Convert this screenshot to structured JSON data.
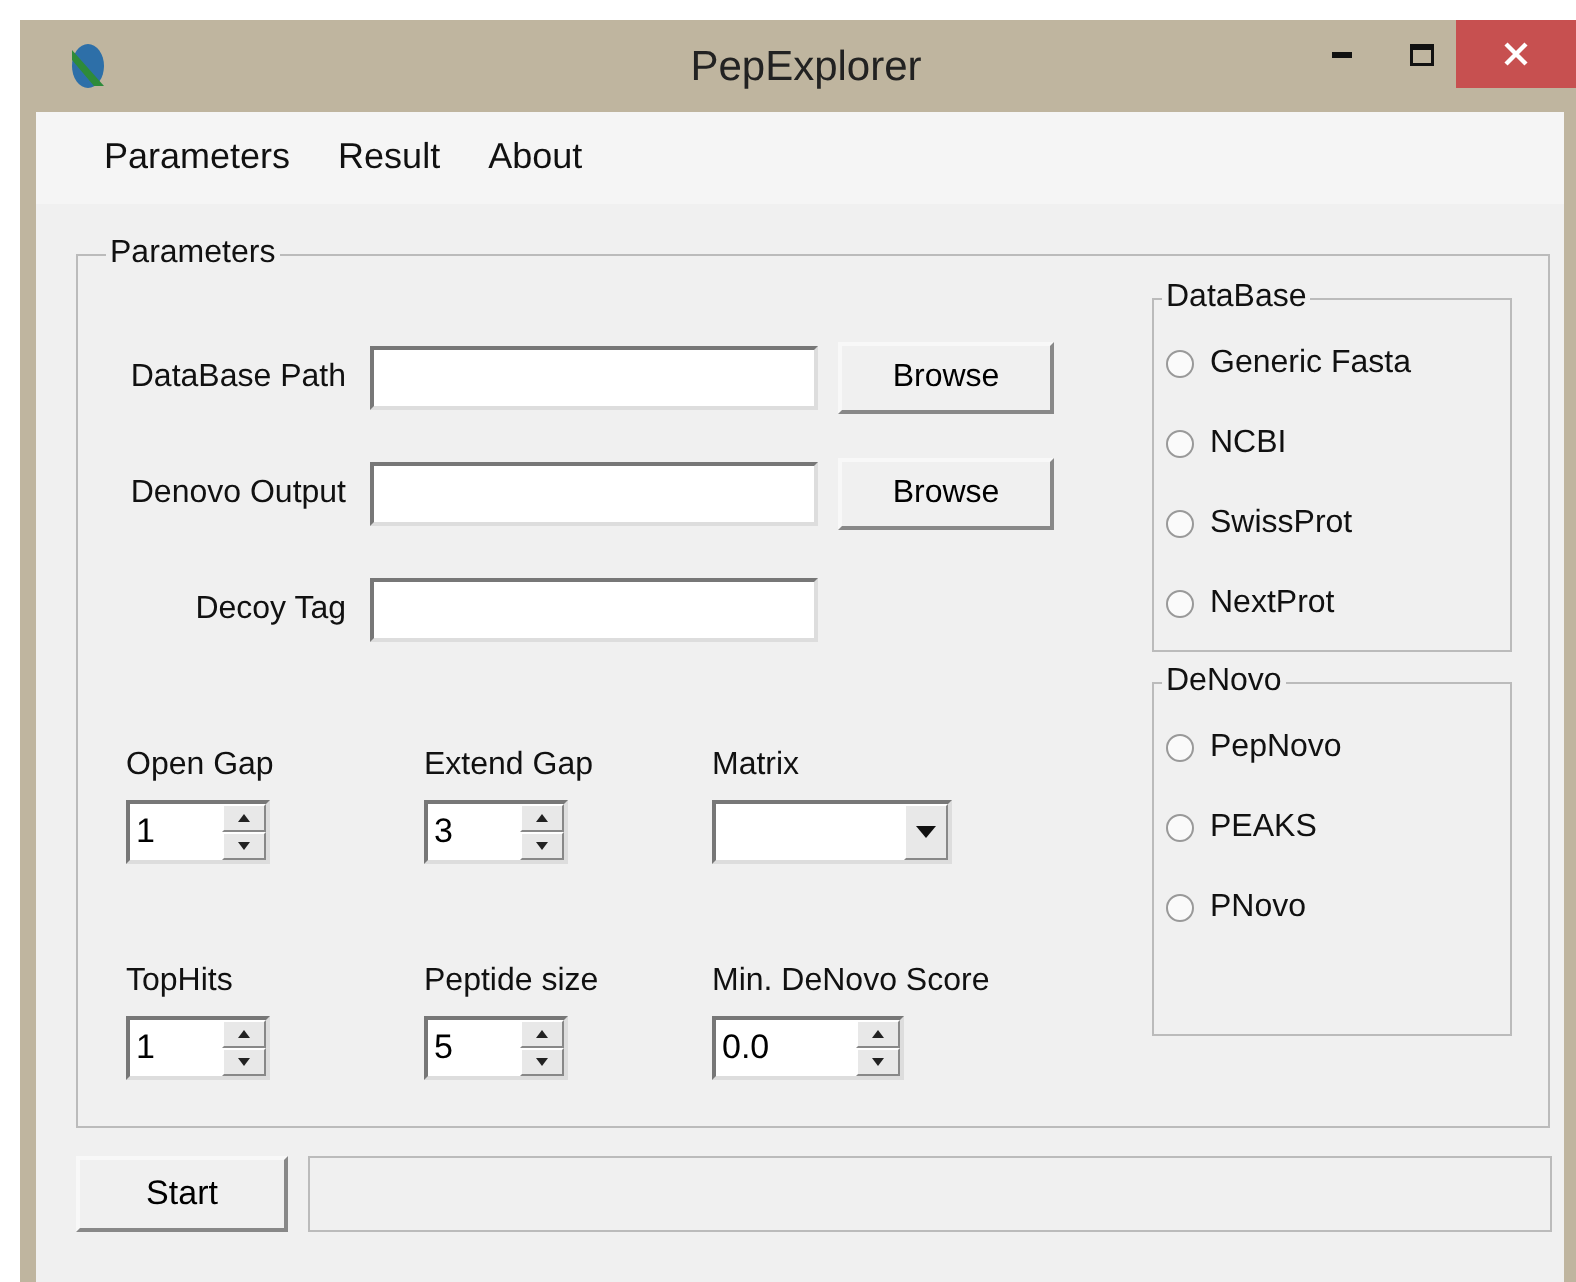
{
  "window": {
    "title": "PepExplorer"
  },
  "menu": [
    "Parameters",
    "Result",
    "About"
  ],
  "parameters": {
    "title": "Parameters",
    "paths": [
      {
        "label": "DataBase Path",
        "button": "Browse"
      },
      {
        "label": "Denovo Output",
        "button": "Browse"
      },
      {
        "label": "Decoy Tag"
      }
    ],
    "settings": [
      {
        "label": "Open Gap",
        "kind": "spinner",
        "value": "1"
      },
      {
        "label": "Extend Gap",
        "kind": "spinner",
        "value": "3"
      },
      {
        "label": "Matrix",
        "kind": "dropdown"
      },
      {
        "label": "TopHits",
        "kind": "spinner",
        "value": "1"
      },
      {
        "label": "Peptide size",
        "kind": "spinner",
        "value": "5"
      },
      {
        "label": "Min. DeNovo Score",
        "kind": "spinner",
        "value": "0.0"
      }
    ],
    "groups": [
      {
        "title": "DataBase",
        "options": [
          {
            "label": "Generic Fasta",
            "selected": false
          },
          {
            "label": "NCBI",
            "selected": false
          },
          {
            "label": "SwissProt",
            "selected": false
          },
          {
            "label": "NextProt",
            "selected": false
          }
        ]
      },
      {
        "title": "DeNovo",
        "options": [
          {
            "label": "PepNovo",
            "selected": false
          },
          {
            "label": "PEAKS",
            "selected": false
          },
          {
            "label": "PNovo",
            "selected": false
          }
        ]
      }
    ]
  },
  "start_button": "Start"
}
